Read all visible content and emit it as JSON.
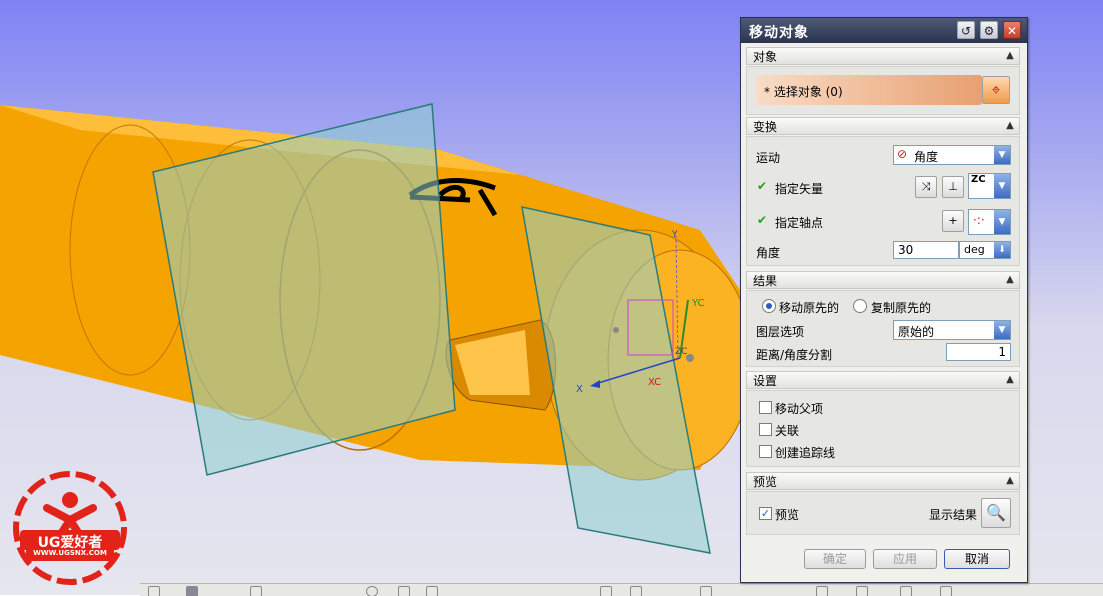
{
  "dialog": {
    "title": "移动对象",
    "sections": {
      "object": {
        "label": "对象",
        "select_label": "* 选择对象 (0)"
      },
      "transform": {
        "label": "变换",
        "motion_label": "运动",
        "motion_value": "角度",
        "vector_label": "指定矢量",
        "vector_axis": "ZC",
        "pivot_label": "指定轴点",
        "angle_label": "角度",
        "angle_value": "30",
        "angle_unit": "deg"
      },
      "result": {
        "label": "结果",
        "move_original": "移动原先的",
        "copy_original": "复制原先的",
        "selected_option": "移动原先的",
        "layer_label": "图层选项",
        "layer_value": "原始的",
        "split_label": "距离/角度分割",
        "split_value": "1"
      },
      "settings": {
        "label": "设置",
        "move_parents": "移动父项",
        "associative": "关联",
        "create_trace": "创建追踪线"
      },
      "preview": {
        "label": "预览",
        "preview_checkbox": "预览",
        "preview_checked": true,
        "show_result": "显示结果"
      }
    },
    "buttons": {
      "ok": "确定",
      "apply": "应用",
      "cancel": "取消"
    }
  },
  "viewport": {
    "axis_labels": {
      "x": "X",
      "xc": "XC",
      "y": "Y",
      "yc": "YC",
      "zc": "ZC"
    },
    "part_color": "#f7a400",
    "plane_color": "#8fd0d0"
  },
  "logo": {
    "brand": "UG爱好者",
    "url": "WWW.UGSNX.COM"
  }
}
